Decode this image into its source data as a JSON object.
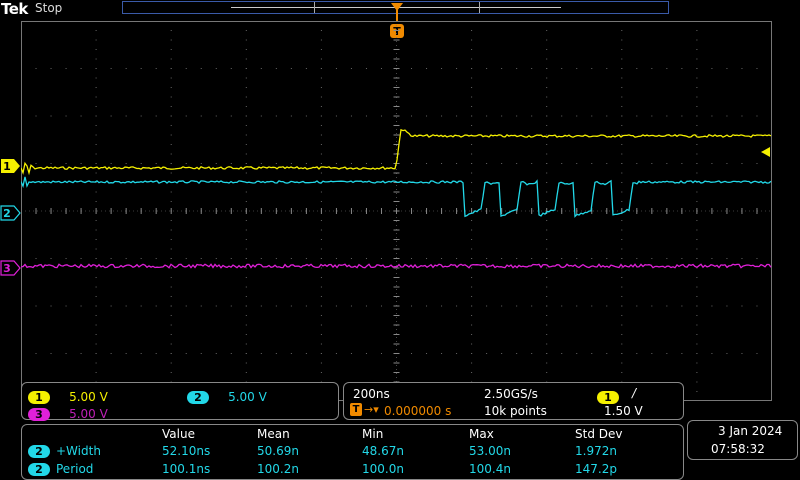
{
  "header": {
    "brand": "Tek",
    "acquisition_state": "Stop",
    "trigger_marker": "T"
  },
  "channels": [
    {
      "number": "1",
      "scale": "5.00 V",
      "color": "#f5f000"
    },
    {
      "number": "2",
      "scale": "5.00 V",
      "color": "#22d8e8"
    },
    {
      "number": "3",
      "scale": "5.00 V",
      "color": "#e020d8"
    }
  ],
  "timebase": {
    "horizontal_scale": "200ns",
    "sample_rate": "2.50GS/s",
    "trigger_channel": "1",
    "trigger_slope": "/",
    "trigger_position": "0.000000 s",
    "record_length": "10k points",
    "trigger_level": "1.50 V"
  },
  "measurements": {
    "headers": [
      "Value",
      "Mean",
      "Min",
      "Max",
      "Std Dev"
    ],
    "rows": [
      {
        "channel": "2",
        "name": "+Width",
        "values": [
          "52.10ns",
          "50.69n",
          "48.67n",
          "53.00n",
          "1.972n"
        ]
      },
      {
        "channel": "2",
        "name": "Period",
        "values": [
          "100.1ns",
          "100.2n",
          "100.0n",
          "100.4n",
          "147.2p"
        ]
      }
    ]
  },
  "datetime": {
    "date": "3 Jan  2024",
    "time": "07:58:32"
  }
}
